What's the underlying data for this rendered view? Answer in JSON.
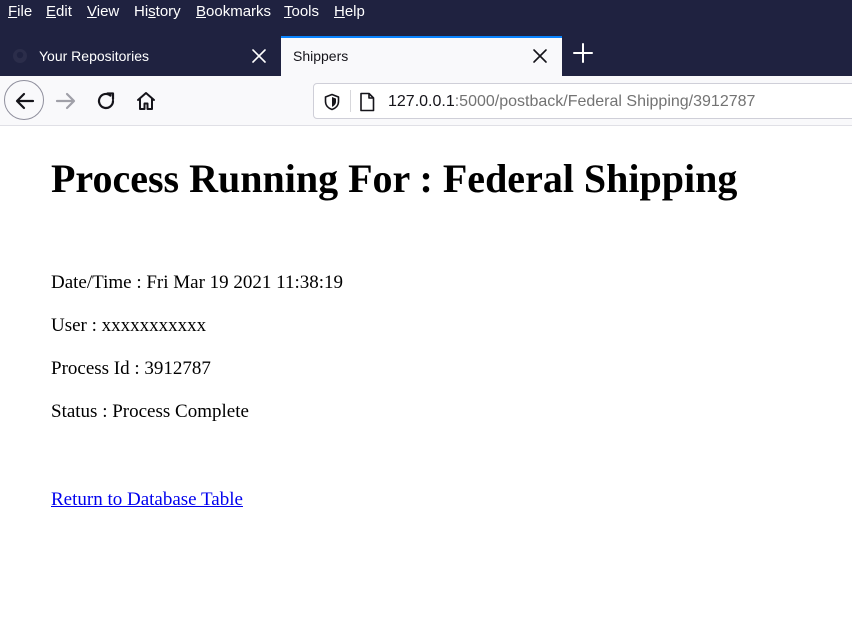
{
  "menu": {
    "items": [
      {
        "accel": "F",
        "rest": "ile"
      },
      {
        "accel": "E",
        "rest": "dit"
      },
      {
        "accel": "V",
        "rest": "iew"
      },
      {
        "pre": "Hi",
        "accel": "s",
        "rest": "tory"
      },
      {
        "accel": "B",
        "rest": "ookmarks"
      },
      {
        "accel": "T",
        "rest": "ools"
      },
      {
        "accel": "H",
        "rest": "elp"
      }
    ]
  },
  "tabs": [
    {
      "title": "Your Repositories",
      "active": false,
      "favicon": "github-icon"
    },
    {
      "title": "Shippers",
      "active": true
    }
  ],
  "toolbar": {
    "icons": [
      "back-icon",
      "forward-icon",
      "reload-icon",
      "home-icon"
    ],
    "url": {
      "host": "127.0.0.1",
      "rest": ":5000/postback/Federal Shipping/3912787"
    }
  },
  "page": {
    "title": "Process Running For : Federal Shipping",
    "lines": [
      "Date/Time : Fri Mar 19 2021 11:38:19",
      "User : xxxxxxxxxxx",
      "Process Id : 3912787",
      "Status : Process Complete"
    ],
    "link": "Return to Database Table"
  },
  "colors": {
    "chrome_dark": "#1f2240",
    "tab_accent": "#0a84ff",
    "link": "#0000ee"
  }
}
